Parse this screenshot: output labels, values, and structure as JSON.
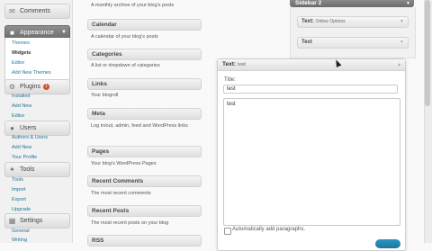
{
  "menu": {
    "comments": "Comments",
    "appearance": "Appearance",
    "appearance_items": [
      "Themes",
      "Widgets",
      "Editor",
      "Add New Themes"
    ],
    "plugins": "Plugins",
    "plugins_badge": "1",
    "plugins_items": [
      "Installed",
      "Add New",
      "Editor"
    ],
    "users": "Users",
    "users_items": [
      "Authors & Users",
      "Add New",
      "Your Profile"
    ],
    "tools": "Tools",
    "tools_items": [
      "Tools",
      "Import",
      "Export",
      "Upgrade"
    ],
    "settings": "Settings",
    "settings_items": [
      "General",
      "Writing"
    ]
  },
  "widgets": [
    {
      "title": "",
      "desc": "A monthly archive of your blog's posts"
    },
    {
      "title": "Calendar",
      "desc": "A calendar of your blog's posts"
    },
    {
      "title": "Categories",
      "desc": "A list or dropdown of categories"
    },
    {
      "title": "Links",
      "desc": "Your blogroll"
    },
    {
      "title": "Meta",
      "desc": "Log in/out, admin, feed and WordPress links"
    },
    {
      "title": "Pages",
      "desc": "Your blog's WordPress Pages"
    },
    {
      "title": "Recent Comments",
      "desc": "The most recent comments"
    },
    {
      "title": "Recent Posts",
      "desc": "The most recent posts on your blog"
    },
    {
      "title": "RSS",
      "desc": ""
    }
  ],
  "sidebar": {
    "title": "Sidebar 2",
    "widgets": [
      {
        "title": "Text:",
        "subtitle": "Online Options"
      },
      {
        "title": "Text",
        "subtitle": ""
      }
    ]
  },
  "editing_widget": {
    "title": "Text:",
    "subtitle": "test",
    "title_label": "Title:",
    "title_value": "test",
    "text_value": "test",
    "auto_paragraph_label": "Automatically add paragraphs."
  }
}
